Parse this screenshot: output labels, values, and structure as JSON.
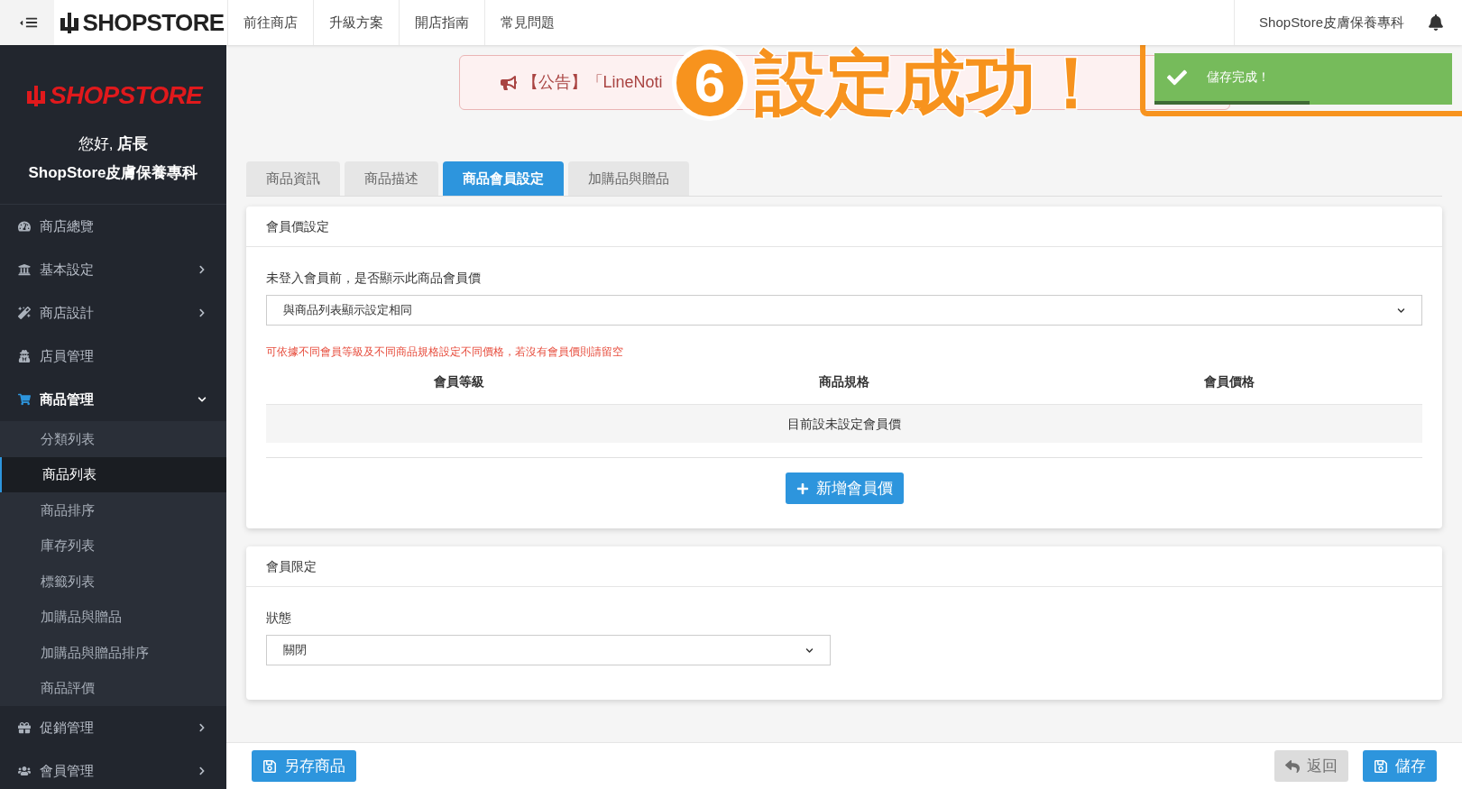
{
  "topbar": {
    "brand": "SHOPSTORE",
    "nav": [
      "前往商店",
      "升級方案",
      "開店指南",
      "常見問題"
    ],
    "store_name": "ShopStore皮膚保養專科"
  },
  "sidebar": {
    "brand": "SHOPSTORE",
    "greeting": "您好, **店長**",
    "store_name": "ShopStore皮膚保養專科",
    "items": [
      {
        "label": "商店總覽"
      },
      {
        "label": "基本設定",
        "expanded": false
      },
      {
        "label": "商店設計",
        "expanded": false
      },
      {
        "label": "店員管理"
      },
      {
        "label": "商品管理",
        "expanded": true,
        "children": [
          {
            "label": "分類列表",
            "selected": false
          },
          {
            "label": "商品列表",
            "selected": true
          },
          {
            "label": "商品排序",
            "selected": false
          },
          {
            "label": "庫存列表",
            "selected": false
          },
          {
            "label": "標籤列表",
            "selected": false
          },
          {
            "label": "加購品與贈品",
            "selected": false
          },
          {
            "label": "加購品與贈品排序",
            "selected": false
          },
          {
            "label": "商品評價",
            "selected": false
          }
        ]
      },
      {
        "label": "促銷管理",
        "expanded": false
      },
      {
        "label": "會員管理",
        "expanded": false
      }
    ]
  },
  "announcement": "【公告】「LineNoti",
  "annotation": {
    "number": "6",
    "text": "設定成功！"
  },
  "toast": {
    "message": "儲存完成！",
    "level": 0.52
  },
  "tabs": [
    {
      "label": "商品資訊",
      "selected": false
    },
    {
      "label": "商品描述",
      "selected": false
    },
    {
      "label": "商品會員設定",
      "selected": true
    },
    {
      "label": "加購品與贈品",
      "selected": false
    }
  ],
  "member_price": {
    "title": "會員價設定",
    "field_label": "未登入會員前，是否顯示此商品會員價",
    "field_value": "與商品列表顯示設定相同",
    "hint": "可依據不同會員等級及不同商品規格設定不同價格，若沒有會員價則請留空",
    "columns": [
      "會員等級",
      "商品規格",
      "會員價格"
    ],
    "empty_message": "目前設未設定會員價",
    "add_button": "新增會員價"
  },
  "member_limit": {
    "title": "會員限定",
    "field_label": "狀態",
    "field_value": "關閉"
  },
  "footer": {
    "save_as": {
      "label": "另存商品",
      "disabled": false
    },
    "back": {
      "label": "返回",
      "disabled": true
    },
    "save": {
      "label": "儲存",
      "disabled": false
    }
  }
}
